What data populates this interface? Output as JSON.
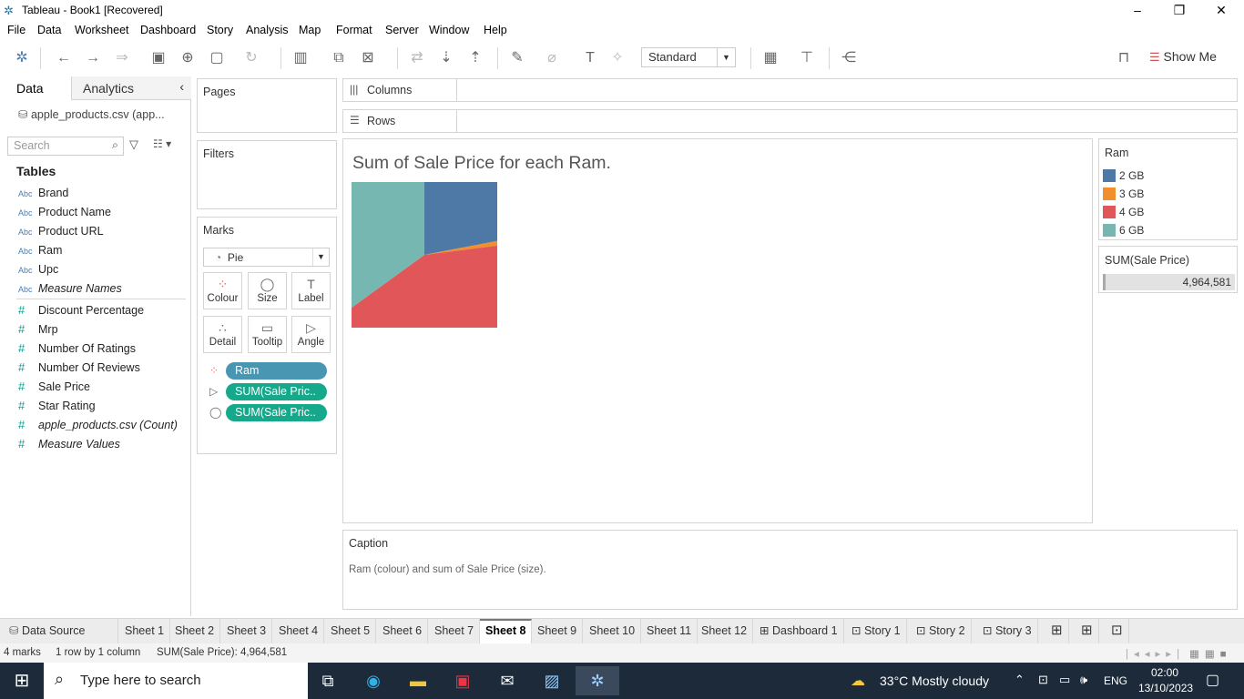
{
  "window": {
    "title": "Tableau - Book1 [Recovered]"
  },
  "menu": [
    "File",
    "Data",
    "Worksheet",
    "Dashboard",
    "Story",
    "Analysis",
    "Map",
    "Format",
    "Server",
    "Window",
    "Help"
  ],
  "toolbar": {
    "fit_select": "Standard",
    "show_me": "Show Me"
  },
  "data_pane": {
    "tab_data": "Data",
    "tab_analytics": "Analytics",
    "datasource": "apple_products.csv (app...",
    "search_placeholder": "Search",
    "tables_heading": "Tables",
    "dimensions": [
      {
        "type": "Abc",
        "name": "Brand"
      },
      {
        "type": "Abc",
        "name": "Product Name"
      },
      {
        "type": "Abc",
        "name": "Product URL"
      },
      {
        "type": "Abc",
        "name": "Ram"
      },
      {
        "type": "Abc",
        "name": "Upc"
      },
      {
        "type": "Abc",
        "name": "Measure Names"
      }
    ],
    "measures": [
      {
        "type": "#",
        "name": "Discount Percentage"
      },
      {
        "type": "#",
        "name": "Mrp"
      },
      {
        "type": "#",
        "name": "Number Of Ratings"
      },
      {
        "type": "#",
        "name": "Number Of Reviews"
      },
      {
        "type": "#",
        "name": "Sale Price"
      },
      {
        "type": "#",
        "name": "Star Rating"
      },
      {
        "type": "#",
        "name": "apple_products.csv (Count)"
      },
      {
        "type": "#",
        "name": "Measure Values"
      }
    ]
  },
  "cards": {
    "pages": "Pages",
    "filters": "Filters",
    "marks": "Marks",
    "mark_type": "Pie",
    "mark_buttons": [
      "Colour",
      "Size",
      "Label",
      "Detail",
      "Tooltip",
      "Angle"
    ],
    "pills": [
      "Ram",
      "SUM(Sale Pric..",
      "SUM(Sale Pric.."
    ],
    "pill_colors": [
      "#4996b2",
      "#15a88a",
      "#15a88a"
    ]
  },
  "shelves": {
    "columns": "Columns",
    "rows": "Rows"
  },
  "view": {
    "title": "Sum of Sale Price for each Ram."
  },
  "chart_data": {
    "type": "pie",
    "title": "Sum of Sale Price for each Ram.",
    "categories": [
      "2 GB",
      "3 GB",
      "4 GB",
      "6 GB"
    ],
    "values": [
      0.22,
      0.01,
      0.42,
      0.35
    ],
    "colors": [
      "#4e79a7",
      "#f28e2b",
      "#e15759",
      "#76b7b2"
    ],
    "total": "4,964,581"
  },
  "legend": {
    "title": "Ram",
    "items": [
      {
        "label": "2 GB",
        "color": "#4e79a7"
      },
      {
        "label": "3 GB",
        "color": "#f28e2b"
      },
      {
        "label": "4 GB",
        "color": "#e15759"
      },
      {
        "label": "6 GB",
        "color": "#76b7b2"
      }
    ]
  },
  "size_legend": {
    "title": "SUM(Sale Price)",
    "value": "4,964,581"
  },
  "caption": {
    "title": "Caption",
    "text": "Ram (colour) and sum of Sale Price (size)."
  },
  "sheet_tabs": [
    "Data Source",
    "Sheet 1",
    "Sheet 2",
    "Sheet 3",
    "Sheet 4",
    "Sheet 5",
    "Sheet 6",
    "Sheet 7",
    "Sheet 8",
    "Sheet 9",
    "Sheet 10",
    "Sheet 11",
    "Sheet 12",
    "Dashboard 1",
    "Story 1",
    "Story 2",
    "Story 3"
  ],
  "active_tab": "Sheet 8",
  "status": {
    "marks": "4 marks",
    "rows": "1 row  by  1 column",
    "sum": "SUM(Sale Price): 4,964,581"
  },
  "taskbar": {
    "search": "Type here to search",
    "weather": "33°C  Mostly cloudy",
    "lang": "ENG",
    "time": "02:00",
    "date": "13/10/2023"
  }
}
